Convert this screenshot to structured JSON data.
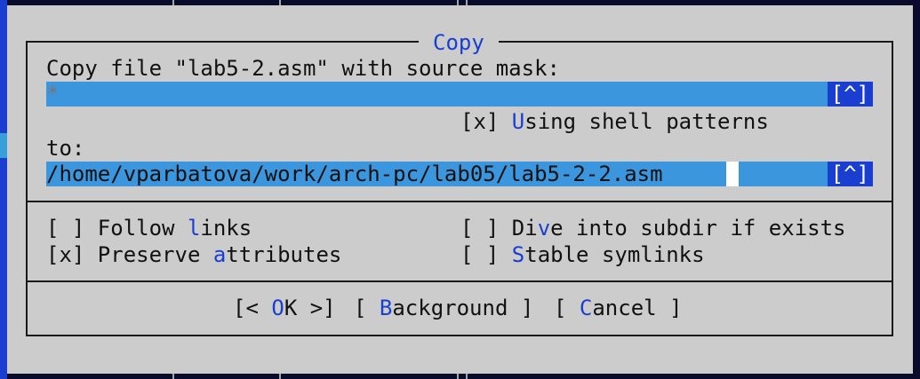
{
  "dialog": {
    "title": "Copy",
    "source_prompt": "Copy file \"lab5-2.asm\" with source mask:",
    "source_mask_value": "*",
    "history_button": "[^]",
    "shell_patterns": {
      "mark": "[x] ",
      "hot": "U",
      "rest": "sing shell patterns"
    },
    "to_label": "to:",
    "destination_value": "/home/vparbatova/work/arch-pc/lab05/lab5-2-2.asm",
    "options": {
      "follow_links": {
        "mark": "[ ] ",
        "pre": "Follow ",
        "hot": "l",
        "post": "inks"
      },
      "preserve_attributes": {
        "mark": "[x] ",
        "pre": "Preserve ",
        "hot": "a",
        "post": "ttributes"
      },
      "dive_into_subdir": {
        "mark": "[ ] ",
        "pre": "Di",
        "hot": "v",
        "post": "e into subdir if exists"
      },
      "stable_symlinks": {
        "mark": "[ ] ",
        "pre": "",
        "hot": "S",
        "post": "table symlinks"
      }
    },
    "buttons": {
      "ok": {
        "pre": "[< ",
        "hot": "O",
        "post": "K >]"
      },
      "background": {
        "pre": "[ ",
        "hot": "B",
        "post": "ackground ]"
      },
      "cancel": {
        "pre": "[ ",
        "hot": "C",
        "post": "ancel ]"
      }
    }
  },
  "colors": {
    "dialog_bg": "#cccccc",
    "accent": "#1a3fd0",
    "input_bg": "#3b96dd"
  }
}
